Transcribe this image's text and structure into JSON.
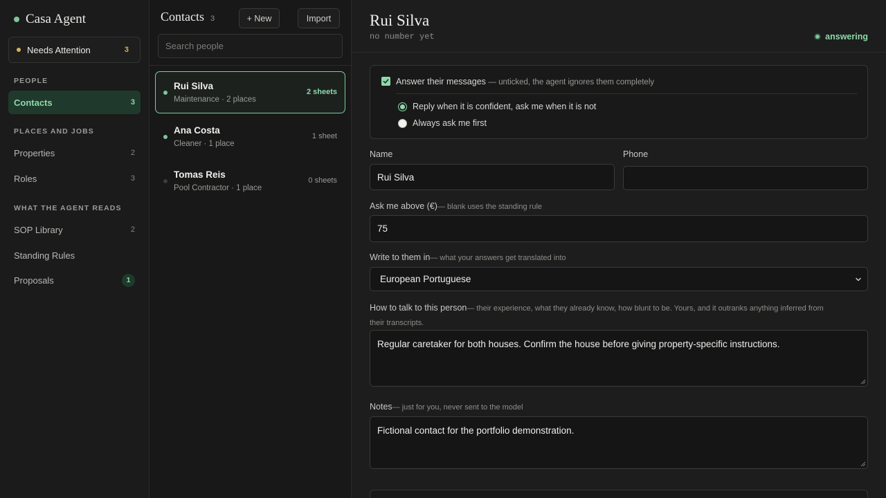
{
  "sidebar": {
    "brand": "Casa Agent",
    "attention": {
      "label": "Needs Attention",
      "count": "3"
    },
    "sections": {
      "people": "People",
      "places": "Places and Jobs",
      "reads": "What the Agent Reads"
    },
    "items": [
      {
        "label": "Contacts",
        "count": "3"
      },
      {
        "label": "Properties",
        "count": "2"
      },
      {
        "label": "Roles",
        "count": "3"
      },
      {
        "label": "SOP Library",
        "count": "2"
      },
      {
        "label": "Standing Rules",
        "count": ""
      },
      {
        "label": "Proposals",
        "count": "1"
      }
    ]
  },
  "list": {
    "title": "Contacts",
    "count": "3",
    "new_label": "+ New",
    "import_label": "Import",
    "search_placeholder": "Search people",
    "contacts": [
      {
        "name": "Rui Silva",
        "sub": "Maintenance · 2 places",
        "sheets": "2 sheets"
      },
      {
        "name": "Ana Costa",
        "sub": "Cleaner · 1 place",
        "sheets": "1 sheet"
      },
      {
        "name": "Tomas Reis",
        "sub": "Pool Contractor · 1 place",
        "sheets": "0 sheets"
      }
    ]
  },
  "detail": {
    "name": "Rui Silva",
    "number": "no number yet",
    "status": "answering",
    "answer": {
      "label": "Answer their messages",
      "note": "— unticked, the agent ignores them completely",
      "option_confident": "Reply when it is confident, ask me when it is not",
      "option_always": "Always ask me first"
    },
    "fields": {
      "name_label": "Name",
      "name_value": "Rui Silva",
      "phone_label": "Phone",
      "phone_value": "",
      "threshold_label": "Ask me above (€)",
      "threshold_hint": "— blank uses the standing rule",
      "threshold_value": "75",
      "language_label": "Write to them in",
      "language_hint": "— what your answers get translated into",
      "language_value": "European Portuguese",
      "talk_label": "How to talk to this person",
      "talk_hint": "— their experience, what they already know, how blunt to be. Yours, and it outranks anything inferred from their transcripts.",
      "talk_value": "Regular caretaker for both houses. Confirm the house before giving property-specific instructions.",
      "notes_label": "Notes",
      "notes_hint": "— just for you, never sent to the model",
      "notes_value": "Fictional contact for the portfolio demonstration."
    }
  },
  "colors": {
    "accent": "#8fd8aa",
    "attention": "#d9b25c",
    "background": "#161716"
  }
}
